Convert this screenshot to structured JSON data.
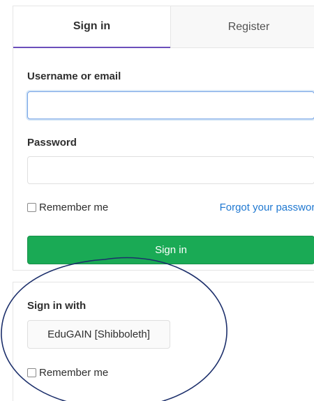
{
  "tabs": {
    "signin": "Sign in",
    "register": "Register"
  },
  "form": {
    "username_label": "Username or email",
    "username_value": "",
    "password_label": "Password",
    "password_value": "",
    "remember_label": "Remember me",
    "forgot_link": "Forgot your password?",
    "submit_label": "Sign in"
  },
  "omniauth": {
    "heading": "Sign in with",
    "provider_label": "EduGAIN [Shibboleth]",
    "remember_label": "Remember me"
  },
  "colors": {
    "tab_active_underline": "#6b4fbb",
    "link": "#1f78d1",
    "primary_button": "#1aaa55",
    "annotation_stroke": "#1c2f6b"
  }
}
